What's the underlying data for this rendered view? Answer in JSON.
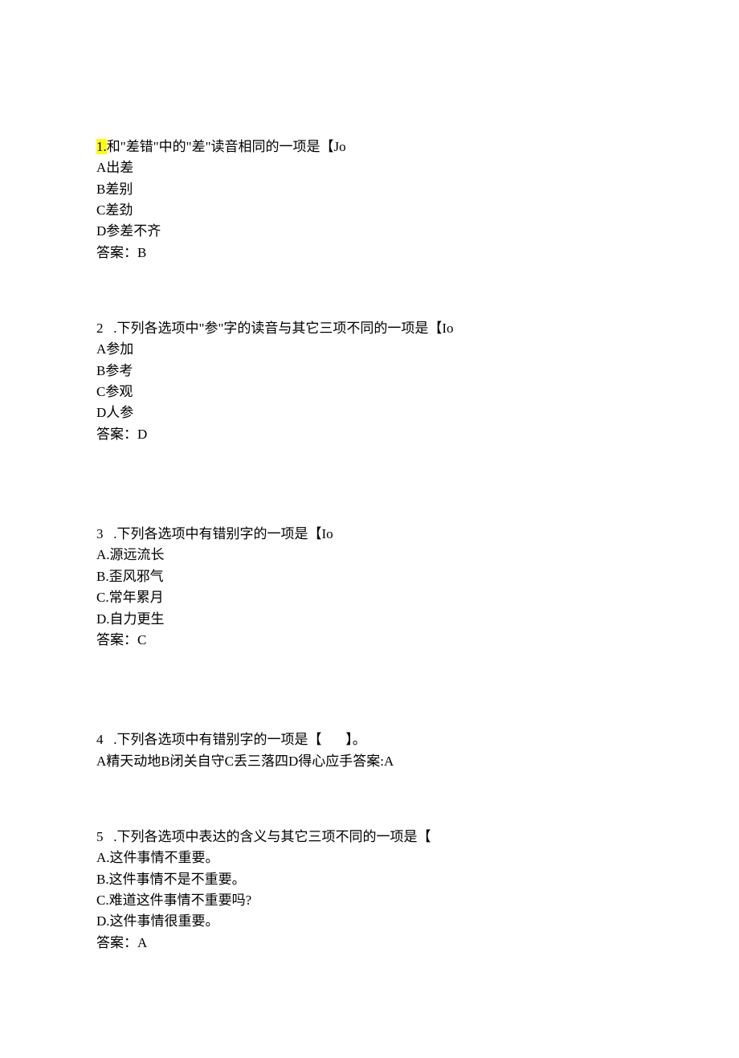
{
  "q1": {
    "num_hl": "1.",
    "stem_rest": "和\"差错\"中的\"差\"读音相同的一项是【Jo",
    "a": "A出差",
    "b": "B差别",
    "c": "C差劲",
    "d": "D参差不齐",
    "ans": "答案：B"
  },
  "q2": {
    "stem": "2   .下列各选项中\"参\"字的读音与其它三项不同的一项是【Io",
    "a": "A参加",
    "b": "B参考",
    "c": "C参观",
    "d": "D人参",
    "ans": "答案：D"
  },
  "q3": {
    "stem": "3   .下列各选项中有错别字的一项是【Io",
    "a": "A.源远流长",
    "b": "B.歪风邪气",
    "c": "C.常年累月",
    "d": "D.自力更生",
    "ans": "答案：C"
  },
  "q4": {
    "stem": "4   .下列各选项中有错别字的一项是【       】。",
    "line": "A精天动地B闭关自守C丢三落四D得心应手答案:A"
  },
  "q5": {
    "stem": "5   .下列各选项中表达的含义与其它三项不同的一项是【",
    "a": "A.这件事情不重要。",
    "b": "B.这件事情不是不重要。",
    "c": "C.难道这件事情不重要吗?",
    "d": "D.这件事情很重要。",
    "ans": "答案：A"
  }
}
